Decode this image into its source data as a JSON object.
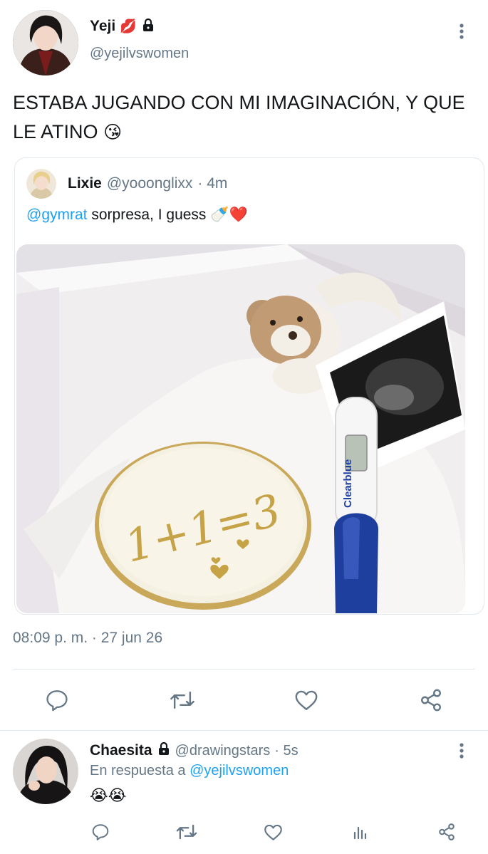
{
  "tweet": {
    "author_name": "Yeji",
    "author_emoji": "💋",
    "author_handle": "@yejilvswomen",
    "text_line1": "ESTABA JUGANDO CON MI IMAGINACIÓN, Y QUE",
    "text_line2": "LE ATINO",
    "text_emoji": "😘",
    "timestamp": "08:09 p. m. · 27 jun 26"
  },
  "quote": {
    "author_name": "Lixie",
    "author_handle": "@yooonglixx",
    "time": "· 4m",
    "mention": "@gymrat",
    "text": "sorpresa, I guess",
    "emoji1": "🍼",
    "emoji2": "❤️",
    "image_text": "1+1=3",
    "image_brand": "Clearblue"
  },
  "reply": {
    "author_name": "Chaesita",
    "author_handle": "@drawingstars",
    "time": "· 5s",
    "in_reply_prefix": "En respuesta a",
    "in_reply_handle": "@yejilvswomen",
    "text": "😭😭"
  },
  "icons": [
    "more-icon",
    "lock-icon",
    "reply-icon",
    "retweet-icon",
    "like-icon",
    "share-icon",
    "analytics-icon"
  ],
  "colors": {
    "link": "#1da1f2",
    "muted": "#657786",
    "border": "#e1e8ed",
    "test_blue": "#1f3f9e"
  }
}
